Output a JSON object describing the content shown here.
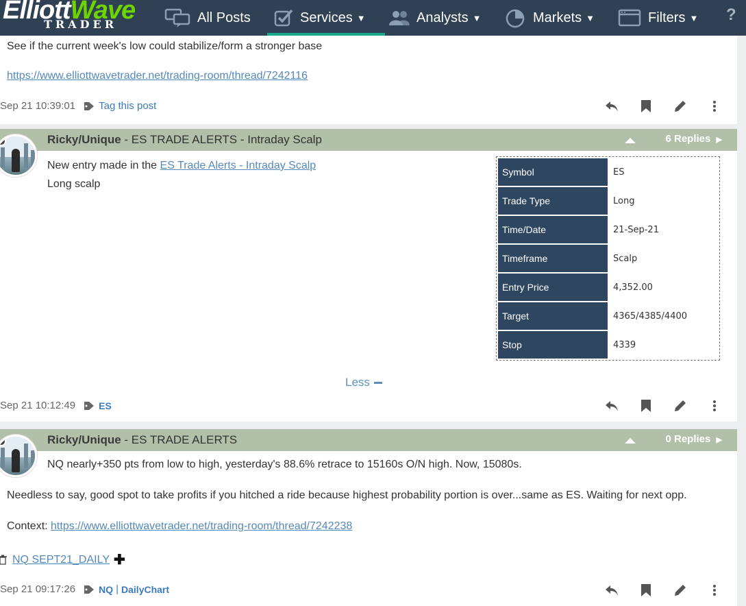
{
  "nav": {
    "logo_line1_a": "Elliott",
    "logo_line1_b": "Wave",
    "logo_line2": "TRADER",
    "all_posts": "All Posts",
    "services": "Services",
    "analysts": "Analysts",
    "markets": "Markets",
    "filters": "Filters",
    "help": "?"
  },
  "post0": {
    "text": "See if the current week's low could stabilize/form a stronger base",
    "link": "https://www.elliottwavetrader.net/trading-room/thread/7242116",
    "time": "Sep 21 10:39:01",
    "tag_label": "Tag this post"
  },
  "post1": {
    "author": "Ricky/Unique",
    "title": " - ES TRADE ALERTS - Intraday Scalp",
    "replies": "6 Replies",
    "text_prefix": "New entry made in the ",
    "link": "ES Trade Alerts - Intraday Scalp",
    "text2": "Long scalp",
    "table": [
      {
        "k": "Symbol",
        "v": "ES"
      },
      {
        "k": "Trade Type",
        "v": "Long"
      },
      {
        "k": "Time/Date",
        "v": "21-Sep-21"
      },
      {
        "k": "Timeframe",
        "v": "Scalp"
      },
      {
        "k": "Entry Price",
        "v": "4,352.00"
      },
      {
        "k": "Target",
        "v": "4365/4385/4400"
      },
      {
        "k": "Stop",
        "v": "4339"
      }
    ],
    "less": "Less",
    "time": "Sep 21 10:12:49",
    "tag": "ES"
  },
  "post2": {
    "author": "Ricky/Unique",
    "title": " - ES TRADE ALERTS",
    "replies": "0 Replies",
    "text1": "NQ nearly+350 pts from low to high, yesterday's 88.6% retrace to 15160s O/N high. Now, 15080s.",
    "text2": "Needless to say, good spot to take profits if you hitched a ride because highest probability portion is over...same as ES. Waiting for next opp.",
    "context_label": "Context: ",
    "context_link": "https://www.elliottwavetrader.net/trading-room/thread/7242238",
    "attachment": "NQ SEPT21_DAILY",
    "time": "Sep 21 09:17:26",
    "tag1": "NQ",
    "tag2": "DailyChart"
  }
}
